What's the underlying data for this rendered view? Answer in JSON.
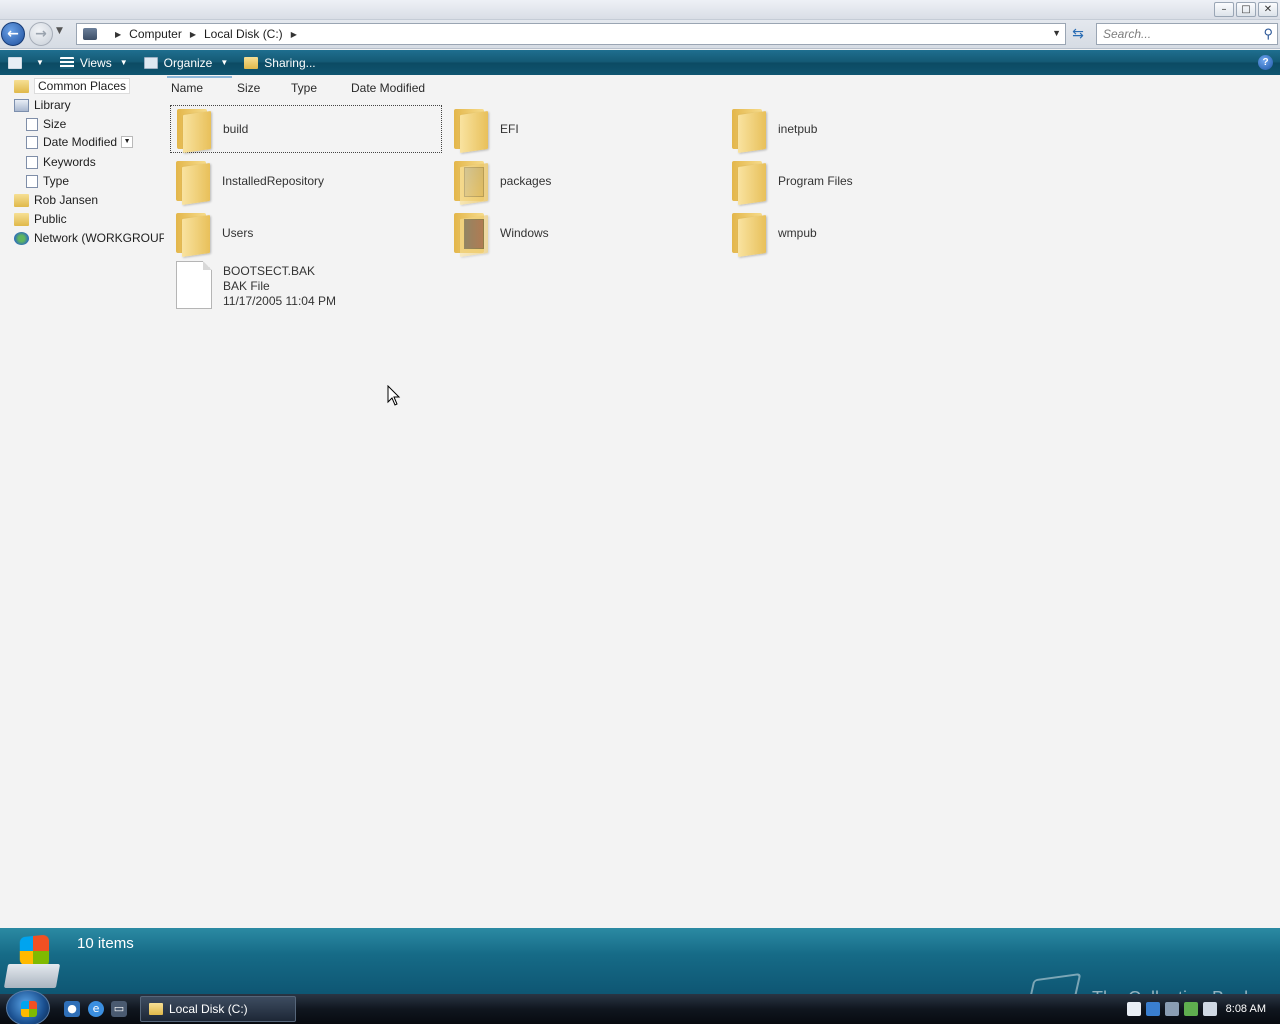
{
  "window": {
    "minimize_label": "–",
    "maximize_label": "□",
    "close_label": "✕"
  },
  "address_bar": {
    "crumbs": [
      "Computer",
      "Local Disk (C:)"
    ],
    "search_placeholder": "Search..."
  },
  "toolbar": {
    "views_label": "Views",
    "organize_label": "Organize",
    "sharing_label": "Sharing...",
    "help_label": "?"
  },
  "sidebar": {
    "items": [
      {
        "label": "Common Places",
        "icon": "folder-icon"
      },
      {
        "label": "Library",
        "icon": "library-icon"
      },
      {
        "label": "Size",
        "icon": "search-folder-icon"
      },
      {
        "label": "Date Modified",
        "icon": "search-folder-icon"
      },
      {
        "label": "Keywords",
        "icon": "search-folder-icon"
      },
      {
        "label": "Type",
        "icon": "search-folder-icon"
      },
      {
        "label": "Rob Jansen",
        "icon": "folder-icon"
      },
      {
        "label": "Public",
        "icon": "folder-icon"
      },
      {
        "label": "Network (WORKGROUP",
        "icon": "network-icon"
      }
    ]
  },
  "columns": [
    "Name",
    "Size",
    "Type",
    "Date Modified"
  ],
  "items": [
    {
      "name": "build",
      "kind": "folder"
    },
    {
      "name": "EFI",
      "kind": "folder"
    },
    {
      "name": "inetpub",
      "kind": "folder"
    },
    {
      "name": "InstalledRepository",
      "kind": "folder"
    },
    {
      "name": "packages",
      "kind": "folder"
    },
    {
      "name": "Program Files",
      "kind": "folder"
    },
    {
      "name": "Users",
      "kind": "folder"
    },
    {
      "name": "Windows",
      "kind": "folder"
    },
    {
      "name": "wmpub",
      "kind": "folder"
    },
    {
      "name": "BOOTSECT.BAK",
      "kind": "file",
      "type_label": "BAK File",
      "date": "11/17/2005 11:04 PM"
    }
  ],
  "details": {
    "count_label": "10 items"
  },
  "taskbar": {
    "task_label": "Local Disk (C:)",
    "clock": "8:08 AM"
  },
  "watermark": "The Collection Book"
}
